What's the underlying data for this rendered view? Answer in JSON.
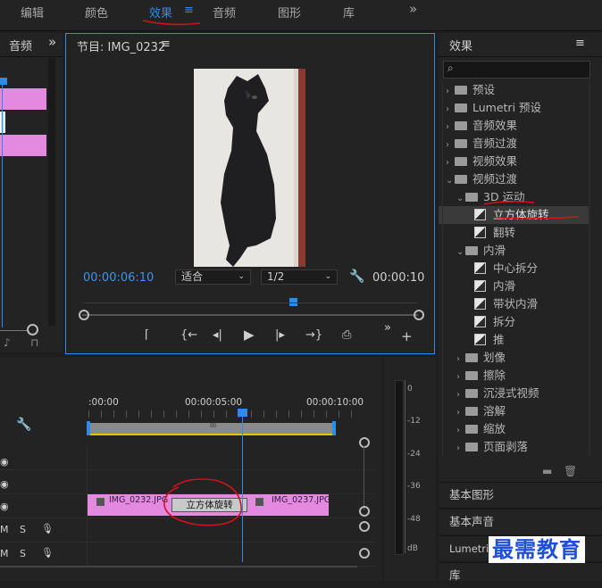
{
  "workspace_tabs": [
    "编辑",
    "颜色",
    "效果",
    "音频",
    "图形",
    "库"
  ],
  "workspace_menu_glyph": "≡",
  "more_glyph": "»",
  "left_panel": {
    "title": "音频"
  },
  "monitor": {
    "title": "节目: IMG_0232",
    "menu_glyph": "≡",
    "current_time": "00:00:06:10",
    "fit_label": "适合",
    "resolution_label": "1/2",
    "duration": "00:00:10"
  },
  "effects_panel": {
    "title": "效果",
    "menu_glyph": "≡",
    "search_placeholder": "",
    "items": [
      {
        "label": "预设",
        "level": 0,
        "kind": "star-folder",
        "expanded": false
      },
      {
        "label": "Lumetri 预设",
        "level": 0,
        "kind": "star-folder",
        "expanded": false
      },
      {
        "label": "音频效果",
        "level": 0,
        "kind": "folder",
        "expanded": false
      },
      {
        "label": "音频过渡",
        "level": 0,
        "kind": "folder",
        "expanded": false
      },
      {
        "label": "视频效果",
        "level": 0,
        "kind": "folder",
        "expanded": false
      },
      {
        "label": "视频过渡",
        "level": 0,
        "kind": "folder",
        "expanded": true
      },
      {
        "label": "3D 运动",
        "level": 1,
        "kind": "folder",
        "expanded": true
      },
      {
        "label": "立方体旋转",
        "level": 2,
        "kind": "effect",
        "selected": true
      },
      {
        "label": "翻转",
        "level": 2,
        "kind": "effect"
      },
      {
        "label": "内滑",
        "level": 1,
        "kind": "folder",
        "expanded": true
      },
      {
        "label": "中心拆分",
        "level": 2,
        "kind": "effect"
      },
      {
        "label": "内滑",
        "level": 2,
        "kind": "effect"
      },
      {
        "label": "带状内滑",
        "level": 2,
        "kind": "effect"
      },
      {
        "label": "拆分",
        "level": 2,
        "kind": "effect"
      },
      {
        "label": "推",
        "level": 2,
        "kind": "effect"
      },
      {
        "label": "划像",
        "level": 1,
        "kind": "folder",
        "expanded": false
      },
      {
        "label": "擦除",
        "level": 1,
        "kind": "folder",
        "expanded": false
      },
      {
        "label": "沉浸式视频",
        "level": 1,
        "kind": "folder",
        "expanded": false
      },
      {
        "label": "溶解",
        "level": 1,
        "kind": "folder",
        "expanded": false
      },
      {
        "label": "缩放",
        "level": 1,
        "kind": "folder",
        "expanded": false
      },
      {
        "label": "页面剥落",
        "level": 1,
        "kind": "folder",
        "expanded": false
      }
    ]
  },
  "lower_panels": [
    "基本图形",
    "基本声音",
    "Lumetri 颜色",
    "库"
  ],
  "timeline": {
    "ruler": [
      ":00:00",
      "00:00:05:00",
      "00:00:10:00"
    ],
    "clips": {
      "clip1": "IMG_0232.JPG",
      "transition": "立方体旋转",
      "clip2": "IMG_0237.JPG"
    },
    "audio_track": {
      "m": "M",
      "s": "S"
    }
  },
  "audio_meter": {
    "labels": [
      "0",
      "-12",
      "-24",
      "-36",
      "-48",
      "dB"
    ]
  },
  "watermark": "最需教育",
  "colors": {
    "accent": "#2d8ceb",
    "clip": "#e38ae0",
    "annotation": "#d4111b"
  }
}
